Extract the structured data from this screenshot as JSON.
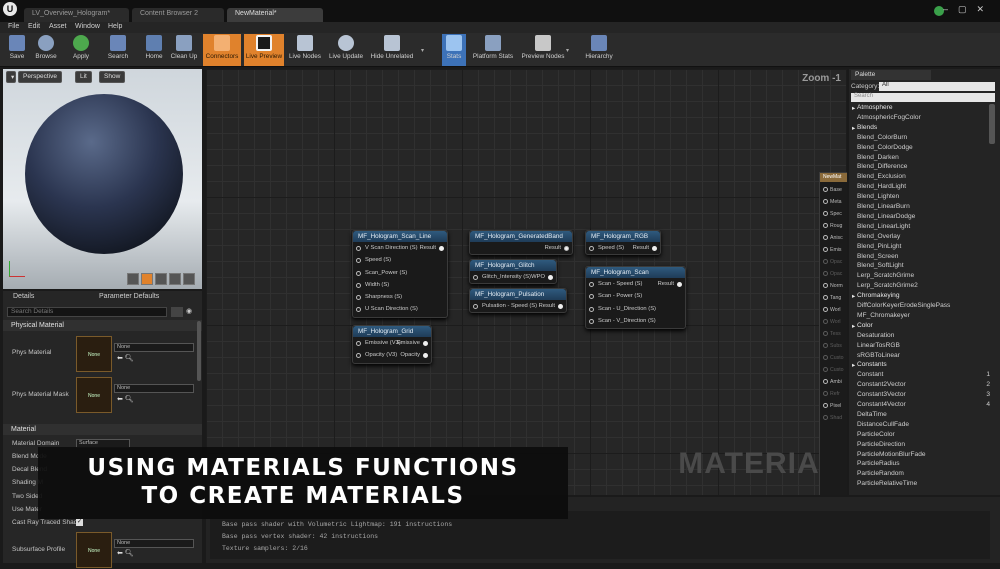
{
  "title_bar": {
    "logo": "U",
    "tabs": [
      "LV_Overview_Hologram*",
      "Content Browser 2",
      "NewMaterial*"
    ],
    "window_controls": "–▢✕"
  },
  "menu": [
    "File",
    "Edit",
    "Asset",
    "Window",
    "Help"
  ],
  "toolbar": [
    {
      "label": "Save",
      "icon": "save-icon"
    },
    {
      "label": "Browse",
      "icon": "browse-icon"
    },
    {
      "label": "Apply",
      "icon": "apply-icon"
    },
    {
      "label": "Search",
      "icon": "search-icon"
    },
    {
      "label": "Home",
      "icon": "home-icon"
    },
    {
      "label": "Clean Up",
      "icon": "cleanup-icon"
    },
    {
      "label": "Connectors",
      "icon": "connectors-icon"
    },
    {
      "label": "Live Preview",
      "icon": "live-preview-icon"
    },
    {
      "label": "Live Nodes",
      "icon": "live-nodes-icon"
    },
    {
      "label": "Live Update",
      "icon": "live-update-icon"
    },
    {
      "label": "Hide Unrelated",
      "icon": "hide-unrelated-icon"
    },
    {
      "label": "Stats",
      "icon": "stats-icon"
    },
    {
      "label": "Platform Stats",
      "icon": "platform-stats-icon"
    },
    {
      "label": "Preview Nodes",
      "icon": "preview-nodes-icon"
    },
    {
      "label": "Hierarchy",
      "icon": "hierarchy-icon"
    }
  ],
  "viewport": {
    "perspective": "Perspective",
    "lit": "Lit",
    "show": "Show"
  },
  "details": {
    "tab_details": "Details",
    "tab_params": "Parameter Defaults",
    "search_placeholder": "Search Details",
    "section_physical": "Physical Material",
    "phys_material": "Phys Material",
    "phys_material_mask": "Phys Material Mask",
    "none": "None",
    "section_material": "Material",
    "material_domain": "Material Domain",
    "material_domain_value": "Surface",
    "blend_mode": "Blend Mode",
    "decal_blend": "Decal Blend",
    "shading_model": "Shading M",
    "two_sided": "Two Sided",
    "use_material": "Use Mater",
    "cast_ray": "Cast Ray Traced Shad",
    "subsurface_profile": "Subsurface Profile"
  },
  "graph": {
    "zoom": "Zoom -1",
    "watermark": "MATERIAL",
    "nodes": {
      "scan_line": {
        "title": "MF_Hologram_Scan_Line",
        "pins": [
          "V Scan Direction (S)",
          "Speed (S)",
          "Scan_Power (S)",
          "Width (S)",
          "Sharpness (S)",
          "U Scan Direction (S)"
        ],
        "out": "Result"
      },
      "grid": {
        "title": "MF_Hologram_Grid",
        "pins": [
          "Emissive (V3)",
          "Opacity (V3)"
        ],
        "outs": [
          "Emissive",
          "Opacity"
        ]
      },
      "band": {
        "title": "MF_Hologram_GeneratedBand",
        "out": "Result"
      },
      "glitch": {
        "title": "MF_Hologram_Glitch",
        "pins": [
          "Glitch_Intensity (S)"
        ],
        "out": "WPO"
      },
      "pulsation": {
        "title": "MF_Hologram_Pulsation",
        "pins": [
          "Pulsation - Speed (S)"
        ],
        "out": "Result"
      },
      "rgb": {
        "title": "MF_Hologram_RGB",
        "pins": [
          "Speed (S)"
        ],
        "out": "Result"
      },
      "scan": {
        "title": "MF_Hologram_Scan",
        "pins": [
          "Scan - Speed (S)",
          "Scan - Power (S)",
          "Scan - U_Direction (S)",
          "Scan - V_Direction (S)"
        ],
        "out": "Result"
      },
      "new_material": {
        "title": "NewMat",
        "pins": [
          "Base",
          "Meta",
          "Spec",
          "Roug",
          "Anisc",
          "Emis",
          "Opac",
          "Opac",
          "Norm",
          "Tang",
          "Worl",
          "Worl",
          "Tess",
          "Subs",
          "Custo",
          "Custo",
          "Ambi",
          "Refr",
          "Pixel",
          "Shad"
        ]
      }
    }
  },
  "palette": {
    "title": "Palette",
    "category_label": "Category:",
    "category_value": "All",
    "search_placeholder": "Search",
    "items": [
      {
        "text": "Atmosphere",
        "cat": true
      },
      {
        "text": "AtmosphericFogColor"
      },
      {
        "text": "Blends",
        "cat": true
      },
      {
        "text": "Blend_ColorBurn"
      },
      {
        "text": "Blend_ColorDodge"
      },
      {
        "text": "Blend_Darken"
      },
      {
        "text": "Blend_Difference"
      },
      {
        "text": "Blend_Exclusion"
      },
      {
        "text": "Blend_HardLight"
      },
      {
        "text": "Blend_Lighten"
      },
      {
        "text": "Blend_LinearBurn"
      },
      {
        "text": "Blend_LinearDodge"
      },
      {
        "text": "Blend_LinearLight"
      },
      {
        "text": "Blend_Overlay"
      },
      {
        "text": "Blend_PinLight"
      },
      {
        "text": "Blend_Screen"
      },
      {
        "text": "Blend_SoftLight"
      },
      {
        "text": "Lerp_ScratchGrime"
      },
      {
        "text": "Lerp_ScratchGrime2"
      },
      {
        "text": "Chromakeying",
        "cat": true
      },
      {
        "text": "DiffColorKeyerErodeSinglePass"
      },
      {
        "text": "MF_Chromakeyer"
      },
      {
        "text": "Color",
        "cat": true
      },
      {
        "text": "Desaturation"
      },
      {
        "text": "LinearTosRGB"
      },
      {
        "text": "sRGBToLinear"
      },
      {
        "text": "Constants",
        "cat": true
      },
      {
        "text": "Constant",
        "num": "1"
      },
      {
        "text": "Constant2Vector",
        "num": "2"
      },
      {
        "text": "Constant3Vector",
        "num": "3"
      },
      {
        "text": "Constant4Vector",
        "num": "4"
      },
      {
        "text": "DeltaTime"
      },
      {
        "text": "DistanceCullFade"
      },
      {
        "text": "ParticleColor"
      },
      {
        "text": "ParticleDirection"
      },
      {
        "text": "ParticleMotionBlurFade"
      },
      {
        "text": "ParticleRadius"
      },
      {
        "text": "ParticleRandom"
      },
      {
        "text": "ParticleRelativeTime"
      }
    ]
  },
  "stats": {
    "lines": [
      "Base pass shader with Volumetric Lightmap: 191 instructions",
      "Base pass vertex shader: 42 instructions",
      "Texture samplers: 2/16"
    ]
  },
  "caption": {
    "line1": "USING MATERIALS FUNCTIONS",
    "line2": "TO CREATE MATERIALS"
  },
  "colors": {
    "accent_orange": "#e0822c",
    "node_header": "#2f5a7e",
    "background": "#1a1a1a"
  }
}
